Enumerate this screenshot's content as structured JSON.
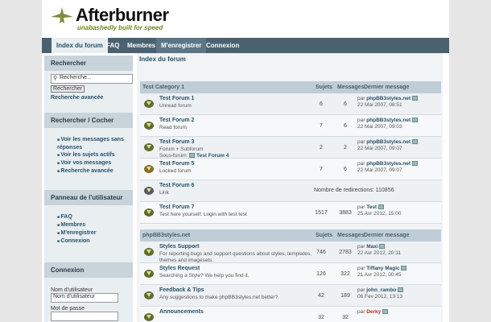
{
  "brand": {
    "title": "Afterburner",
    "tagline": "unabashedly built for speed"
  },
  "nav": [
    {
      "label": "Index du forum",
      "active": true
    },
    {
      "label": "FAQ"
    },
    {
      "label": "Membres"
    },
    {
      "label": "M'enregistrer"
    },
    {
      "label": "Connexion"
    }
  ],
  "sidebar": {
    "search": {
      "title": "Rechercher",
      "placeholder": "Recherche...",
      "button": "Rechercher",
      "advanced": "Recherche avancée"
    },
    "search_check": {
      "title": "Rechercher / Cocher",
      "items": [
        "Voir les messages sans réponses",
        "Voir les sujets actifs",
        "Voir vos messages",
        "Recherche avancée"
      ]
    },
    "user_panel": {
      "title": "Panneau de l'utilisateur",
      "items": [
        "FAQ",
        "Membres",
        "M'enregistrer",
        "Connexion"
      ]
    },
    "login": {
      "title": "Connexion",
      "user_label": "Nom d'utilisateur",
      "user_value": "Nom d'utilisateur",
      "pass_label": "Mot de passe"
    }
  },
  "main": {
    "breadcrumb": "Index du forum",
    "columns": {
      "topics": "Sujets",
      "posts": "Messages",
      "last": "Dernier message"
    },
    "categories": [
      {
        "name": "Test Category 1",
        "forums": [
          {
            "title": "Test Forum 1",
            "desc": "Unread forum",
            "topics": "6",
            "posts": "6",
            "by": "phpBB3styles.net",
            "date": "22 Mai 2007, 08:51"
          },
          {
            "title": "Test Forum 2",
            "desc": "Read forum",
            "topics": "7",
            "posts": "6",
            "by": "phpBB3styles.net",
            "date": "22 Mai 2007, 09:03"
          },
          {
            "title": "Test Forum 3",
            "desc": "Forum + Subforum",
            "sub": "Sous-forum: ",
            "sublink": "Test Forum 4",
            "topics": "2",
            "posts": "2",
            "by": "phpBB3styles.net",
            "date": "22 Mai 2007, 09:07"
          },
          {
            "title": "Test Forum 5",
            "desc": "Locked forum",
            "topics": "7",
            "posts": "6",
            "by": "phpBB3styles.net",
            "date": "22 Mai 2007, 09:07"
          },
          {
            "title": "Test Forum 6",
            "desc": "Link",
            "redirect": "Nombre de redirections: 110856"
          },
          {
            "title": "Test Forum 7",
            "desc": "Test here yourself. Login with test test",
            "topics": "1517",
            "posts": "3883",
            "by": "Test",
            "date": "25 Avr 2012, 15:00"
          }
        ]
      },
      {
        "name": "phpBB3styles.net",
        "forums": [
          {
            "title": "Styles Support",
            "desc": "For reporting bugs and support questions about styles, templates, themes and imagesets.",
            "topics": "746",
            "posts": "2783",
            "by": "Maxi",
            "date": "22 Avr 2012, 20:11"
          },
          {
            "title": "Styles Request",
            "desc": "Searching a Style? We help you find it.",
            "topics": "126",
            "posts": "322",
            "by": "Tiffany Magic",
            "date": "21 Avr 2012, 00:45"
          },
          {
            "title": "Feedback & Tips",
            "desc": "Any suggestions to make phpBB3styles.net better?",
            "topics": "42",
            "posts": "189",
            "by": "john_rambo",
            "date": "06 Fev 2012, 13:13"
          },
          {
            "title": "Announcements",
            "desc": "",
            "topics": "32",
            "posts": "32",
            "by": "Derky",
            "date": ""
          }
        ]
      }
    ],
    "by_prefix": "par "
  }
}
